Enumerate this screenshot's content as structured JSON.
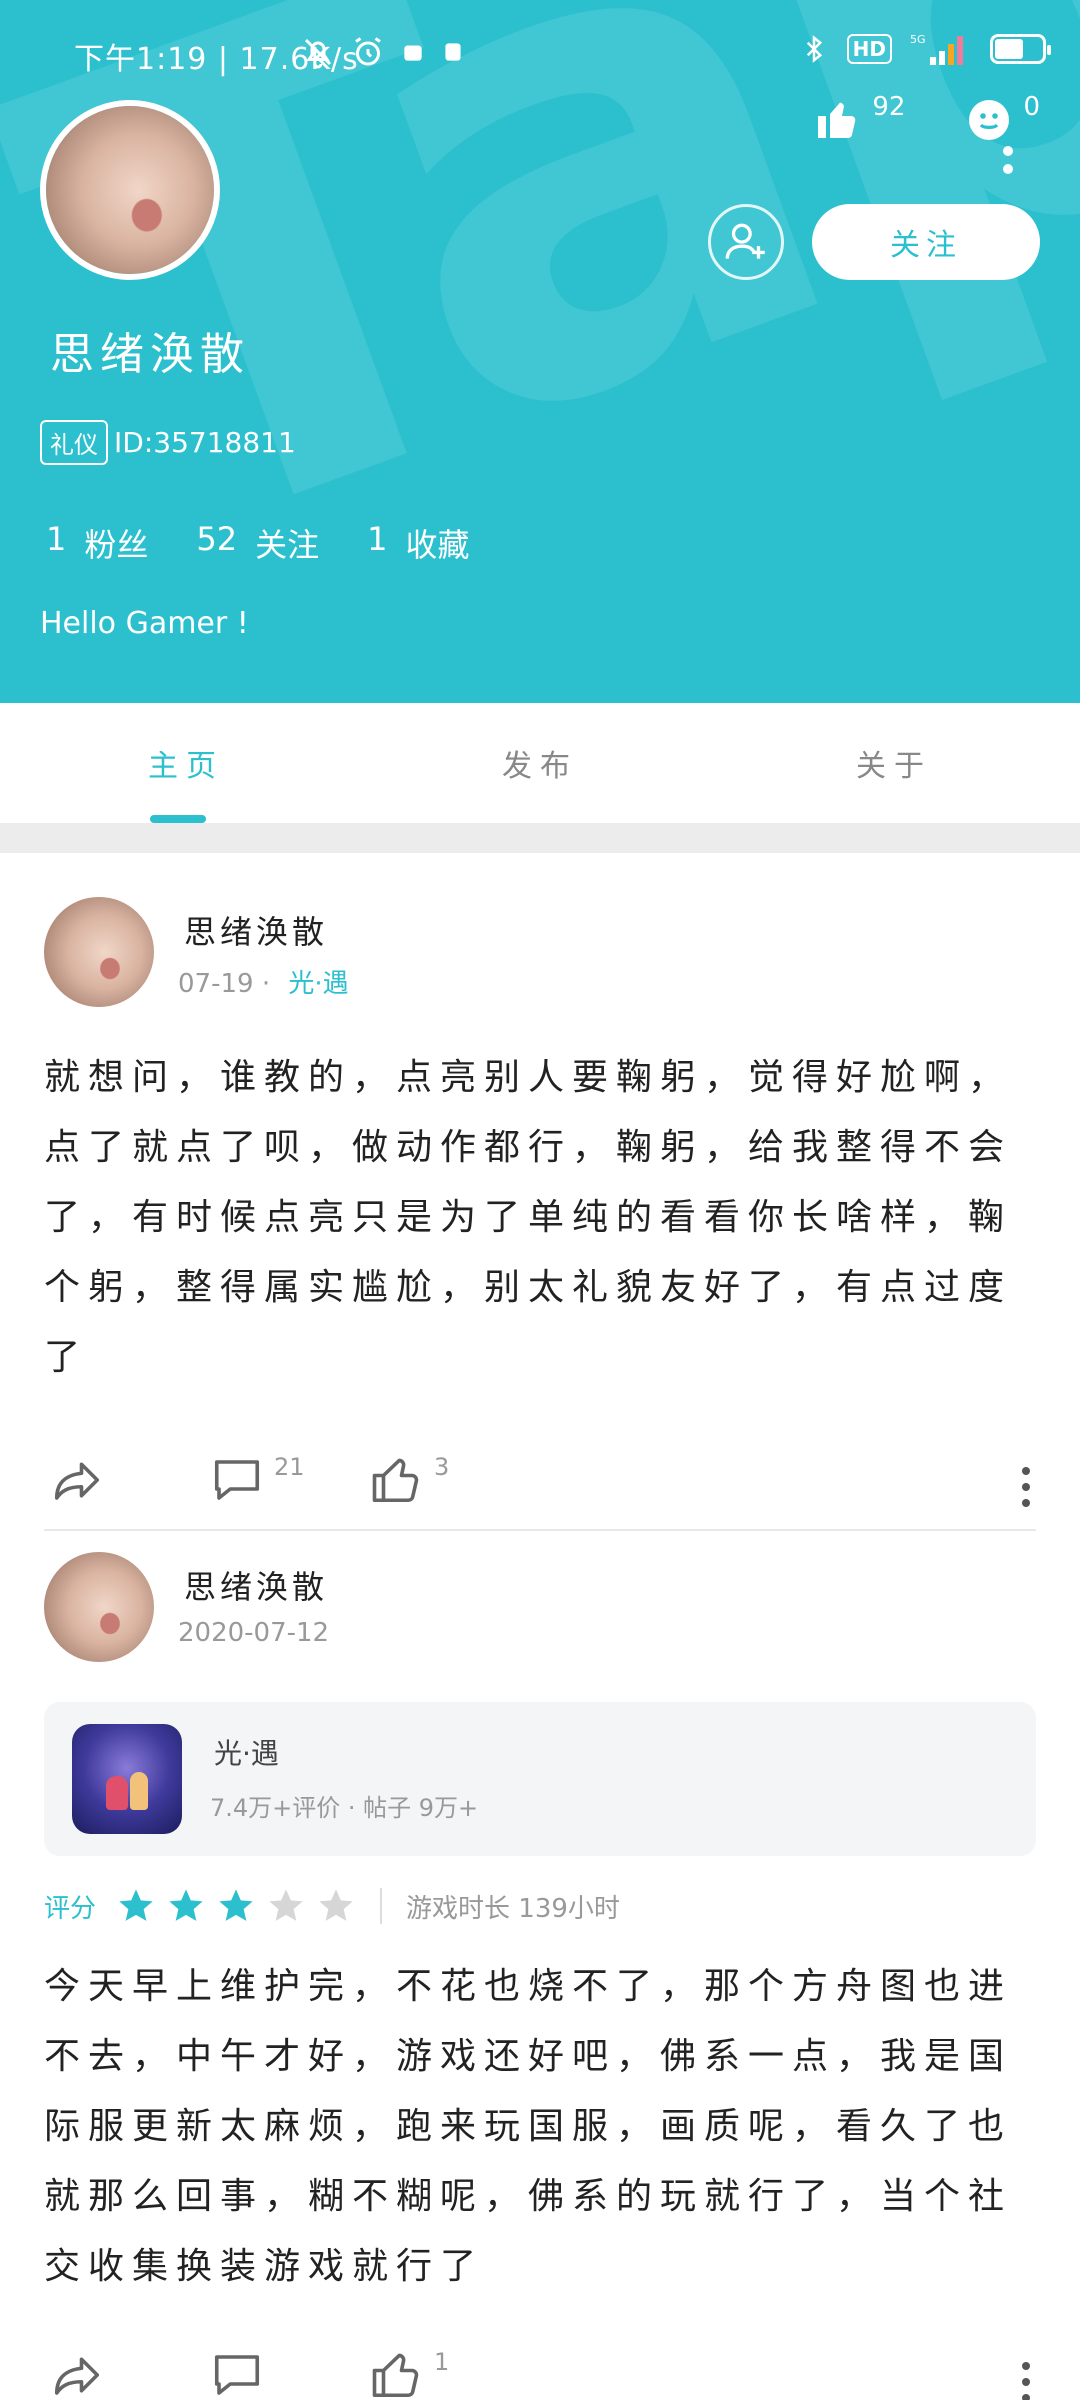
{
  "status_bar": {
    "time_speed": "下午1:19 | 17.6K/s",
    "hd_label": "HD",
    "network": "5G",
    "battery_label": "56"
  },
  "header": {
    "watermark": "TapTap",
    "nickname": "思绪涣散",
    "role_badge": "礼仪",
    "user_id": "ID:35718811",
    "likes": "92",
    "emoji_count": "0",
    "follow_label": "关注",
    "stats": [
      {
        "value": "1",
        "label": "粉丝"
      },
      {
        "value": "52",
        "label": "关注"
      },
      {
        "value": "1",
        "label": "收藏"
      }
    ],
    "bio": "Hello Gamer !"
  },
  "tabs": [
    {
      "label": "主页",
      "active": true
    },
    {
      "label": "发布",
      "active": false
    },
    {
      "label": "关于",
      "active": false
    }
  ],
  "posts": [
    {
      "author": "思绪涣散",
      "date": "07-19",
      "dot": "·",
      "game": "光·遇",
      "body": "就想问，谁教的，点亮别人要鞠躬，觉得好尬啊，点了就点了呗，做动作都行，鞠躬，给我整得不会了，有时候点亮只是为了单纯的看看你长啥样，鞠个躬，整得属实尴尬，别太礼貌友好了，有点过度了",
      "comments": "21",
      "likes": "3"
    },
    {
      "author": "思绪涣散",
      "date": "2020-07-12",
      "game_card": {
        "name": "光·遇",
        "stats": "7.4万+评价 · 帖子 9万+"
      },
      "rating_label": "评分",
      "rating": 3,
      "rating_max": 5,
      "playtime": "游戏时长 139小时",
      "body": "今天早上维护完，不花也烧不了，那个方舟图也进不去，中午才好，游戏还好吧，佛系一点，我是国际服更新太麻烦，跑来玩国服，画质呢，看久了也就那么回事，糊不糊呢，佛系的玩就行了，当个社交收集换装游戏就行了",
      "comments": "",
      "likes": "1"
    }
  ],
  "colors": {
    "accent": "#2cc0cf",
    "star_inactive": "#d6d6d6"
  }
}
